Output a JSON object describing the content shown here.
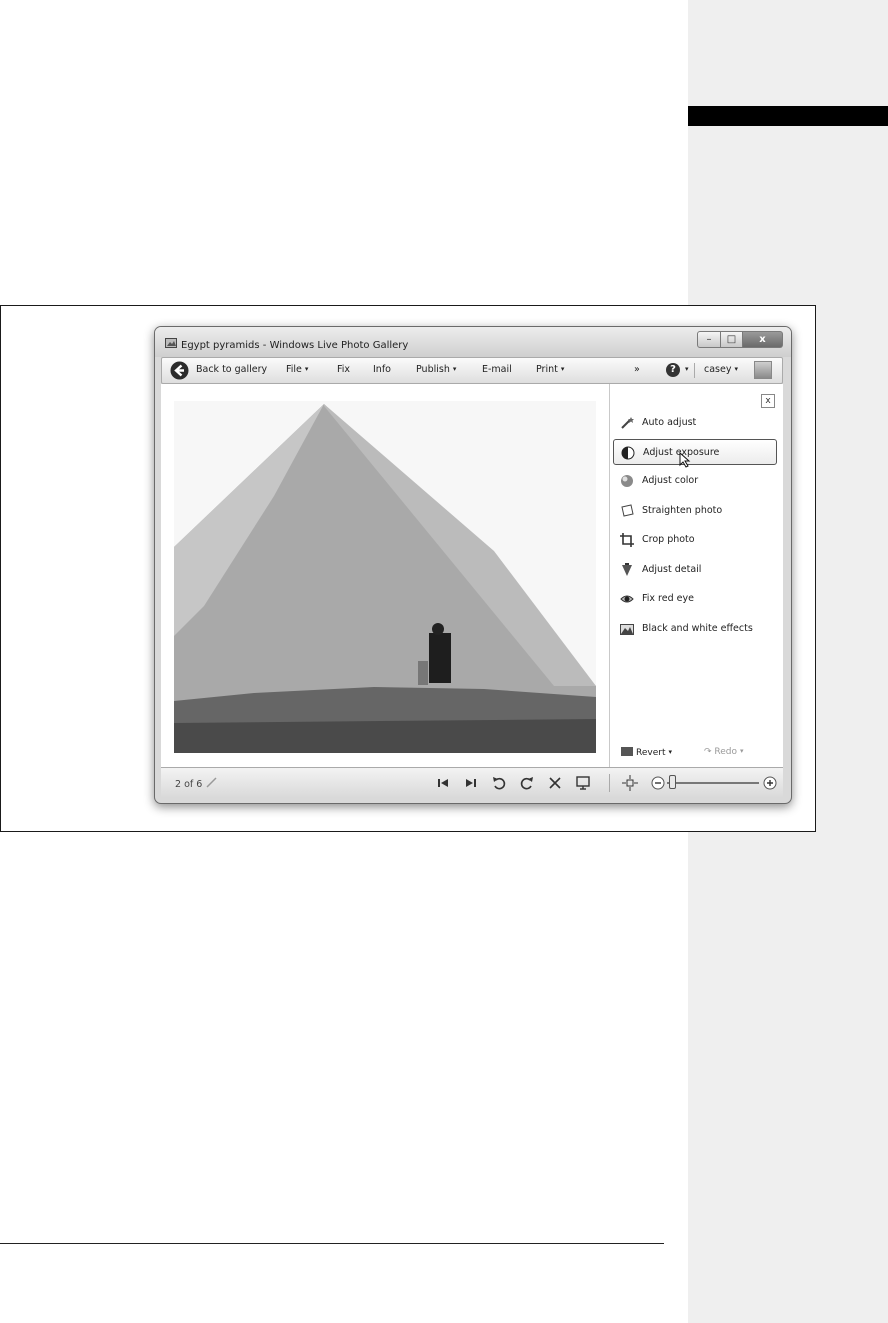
{
  "window": {
    "title": "Egypt pyramids - Windows Live Photo Gallery",
    "controls": {
      "minimize": "–",
      "maximize": "□",
      "close": "x"
    }
  },
  "toolbar": {
    "back_label": "Back to gallery",
    "file_label": "File",
    "fix_label": "Fix",
    "info_label": "Info",
    "publish_label": "Publish",
    "email_label": "E-mail",
    "print_label": "Print",
    "overflow_label": "»",
    "help_label": "?",
    "user_label": "casey",
    "dropdown_caret": "▾"
  },
  "fix_panel": {
    "close_label": "x",
    "tasks": [
      {
        "label": "Auto adjust",
        "icon": "magic-wand-icon"
      },
      {
        "label": "Adjust exposure",
        "icon": "exposure-icon",
        "selected": true
      },
      {
        "label": "Adjust color",
        "icon": "color-ball-icon"
      },
      {
        "label": "Straighten photo",
        "icon": "straighten-icon"
      },
      {
        "label": "Crop photo",
        "icon": "crop-icon"
      },
      {
        "label": "Adjust detail",
        "icon": "detail-icon"
      },
      {
        "label": "Fix red eye",
        "icon": "eye-icon"
      },
      {
        "label": "Black and white effects",
        "icon": "bw-effects-icon"
      }
    ],
    "revert_label": "Revert",
    "redo_label": "Redo"
  },
  "photo": {
    "subject": "pyramid-photo"
  },
  "statusbar": {
    "counter": "2 of 6",
    "buttons": [
      "previous-icon",
      "next-icon",
      "rotate-left-icon",
      "rotate-right-icon",
      "delete-icon",
      "slideshow-icon",
      "actual-size-icon",
      "zoom-out-icon",
      "zoom-in-icon"
    ],
    "zoom_level": 0.05
  }
}
